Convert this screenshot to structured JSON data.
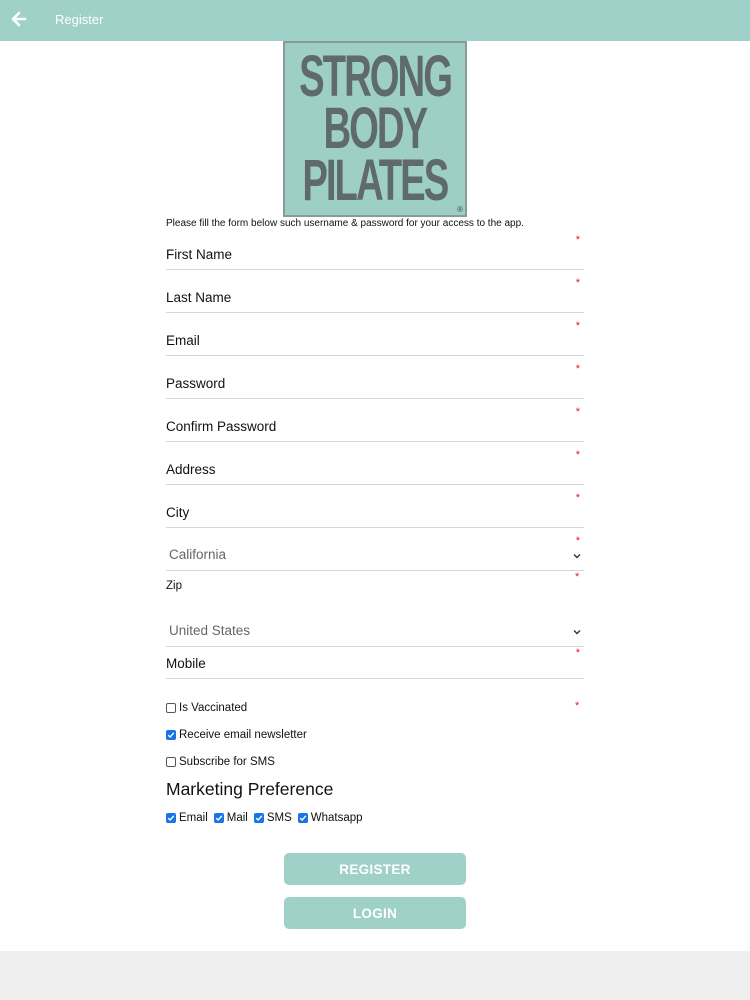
{
  "header": {
    "title": "Register"
  },
  "logo": {
    "line1": "STRONG",
    "line2": "BODY",
    "line3": "PILATES",
    "reg": "®"
  },
  "intro": "Please fill the form below such username & password for your access to the app.",
  "fields": {
    "first_name": {
      "placeholder": "First Name"
    },
    "last_name": {
      "placeholder": "Last Name"
    },
    "email": {
      "placeholder": "Email"
    },
    "password": {
      "placeholder": "Password"
    },
    "confirm_password": {
      "placeholder": "Confirm Password"
    },
    "address": {
      "placeholder": "Address"
    },
    "city": {
      "placeholder": "City"
    },
    "state": {
      "value": "California"
    },
    "zip": {
      "label": "Zip"
    },
    "country": {
      "value": "United States"
    },
    "mobile": {
      "placeholder": "Mobile"
    }
  },
  "required_mark": "*",
  "checks": {
    "vaccinated": {
      "label": "Is Vaccinated",
      "checked": false
    },
    "newsletter": {
      "label": "Receive email newsletter",
      "checked": true
    },
    "sms": {
      "label": "Subscribe for SMS",
      "checked": false
    }
  },
  "marketing": {
    "title": "Marketing Preference",
    "options": [
      {
        "label": "Email",
        "checked": true
      },
      {
        "label": "Mail",
        "checked": true
      },
      {
        "label": "SMS",
        "checked": true
      },
      {
        "label": "Whatsapp",
        "checked": true
      }
    ]
  },
  "buttons": {
    "register": "REGISTER",
    "login": "LOGIN"
  },
  "colors": {
    "accent": "#9fd1c8",
    "required": "#e02020",
    "checkbox": "#1a73e8"
  }
}
